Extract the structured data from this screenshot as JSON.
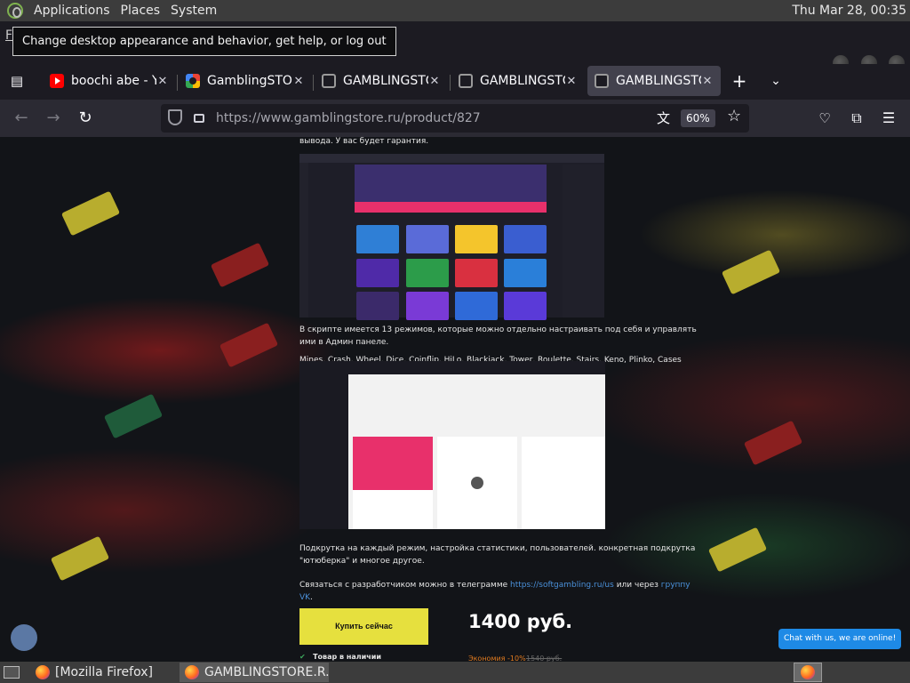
{
  "top_panel": {
    "menus": [
      "Applications",
      "Places",
      "System"
    ],
    "clock": "Thu Mar 28, 00:35"
  },
  "tooltip": "Change desktop appearance and behavior, get help, or log out",
  "tabs": [
    {
      "title": "boochi abe - YouTube",
      "favicon": "youtube-icon"
    },
    {
      "title": "GamblingSTORE",
      "favicon": "google-icon"
    },
    {
      "title": "GAMBLINGSTORE",
      "favicon": "skull-icon"
    },
    {
      "title": "GAMBLINGSTORE",
      "favicon": "skull-icon"
    },
    {
      "title": "GAMBLINGSTORE",
      "favicon": "skull-icon"
    }
  ],
  "navbar": {
    "url": "https://www.gamblingstore.ru/product/827",
    "zoom": "60%"
  },
  "article": {
    "p_top": "вывода. У вас будет гарантия.",
    "p_modes": "В скрипте имеется 13 режимов, которые можно отдельно настраивать под себя и управлять ими в Админ панеле.",
    "p_modes_list": "Mines, Crash, Wheel, Dice, Coinflip, HiLo, Blackjack, Tower, Roulette, Stairs, Keno, Plinko, Cases",
    "p_features": "Подкрутка на каждый режим, настройка статистики, пользователей. конкретная подкрутка \"ютюберка\" и многое другое.",
    "p_contact_prefix": "Связаться с разработчиком можно в телеграмме ",
    "p_contact_link1": "https://softgambling.ru/us",
    "p_contact_mid": " или через ",
    "p_contact_link2": "группу VK",
    "p_contact_suffix": ".",
    "buy_label": "Купить сейчас",
    "price": "1400 руб.",
    "stock": "Товар в наличии",
    "discount": "Экономия -10%",
    "old_price": "1540 руб."
  },
  "chat_online": "Chat with us, we are online!",
  "taskbar": {
    "tasks": [
      "[Mozilla Firefox]",
      "GAMBLINGSTORE.R..."
    ]
  },
  "colors": {
    "accent_yellow": "#e6e03e",
    "link_blue": "#4a90d9",
    "discount_orange": "#e07a1f",
    "chat_blue": "#1e8ae6"
  }
}
